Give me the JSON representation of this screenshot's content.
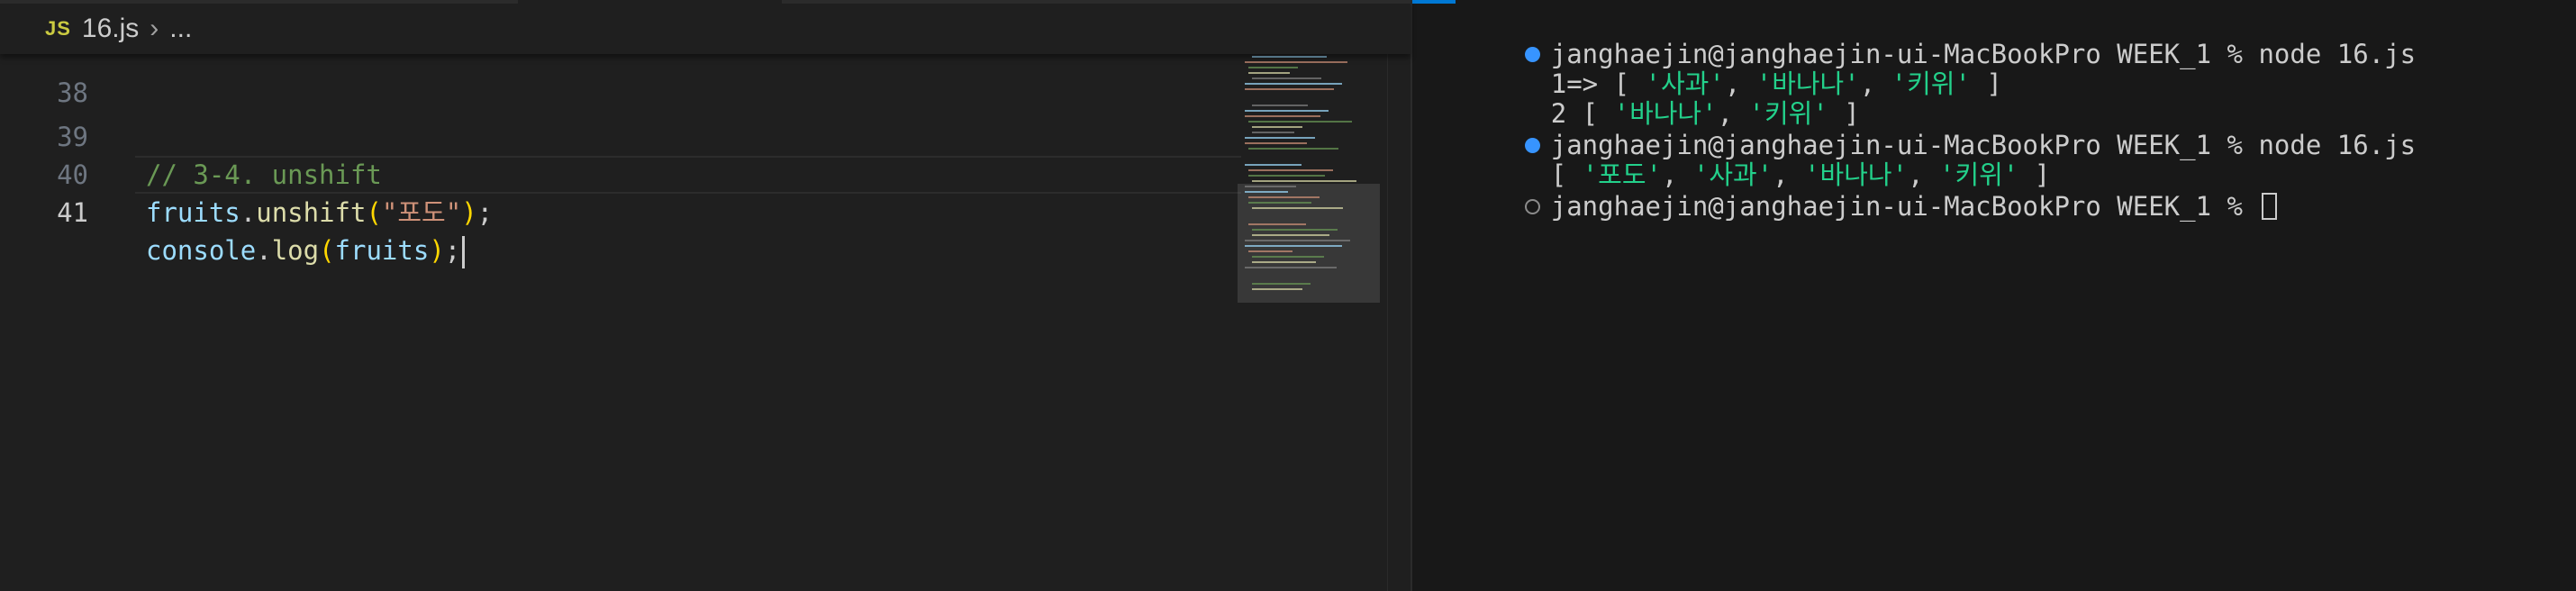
{
  "editor": {
    "breadcrumb": {
      "file_icon": "JS",
      "file_name": "16.js",
      "more": "..."
    },
    "lines": [
      {
        "number": "38"
      },
      {
        "number": "39",
        "comment": "// 3-4. unshift"
      },
      {
        "number": "40",
        "var": "fruits",
        "dot": ".",
        "method": "unshift",
        "open": "(",
        "arg": "\"포도\"",
        "close": ")",
        "semi": ";"
      },
      {
        "number": "41",
        "obj": "console",
        "dot": ".",
        "method": "log",
        "open": "(",
        "arg": "fruits",
        "close": ")",
        "semi": ";"
      }
    ]
  },
  "terminal": {
    "prompt": "janghaejin@janghaejin-ui-MacBookPro WEEK_1 %",
    "lines": [
      {
        "type": "prompt",
        "status": "done",
        "command": "node 16.js"
      },
      {
        "type": "output",
        "prefix": "1=> [ ",
        "items": [
          "'사과'",
          "'바나나'",
          "'키위'"
        ],
        "suffix": " ]"
      },
      {
        "type": "output",
        "prefix": "2 [ ",
        "items": [
          "'바나나'",
          "'키위'"
        ],
        "suffix": " ]"
      },
      {
        "type": "prompt",
        "status": "done",
        "command": "node 16.js"
      },
      {
        "type": "output",
        "prefix": "[ ",
        "items": [
          "'포도'",
          "'사과'",
          "'바나나'",
          "'키위'"
        ],
        "suffix": " ]"
      },
      {
        "type": "prompt",
        "status": "idle",
        "command": ""
      }
    ],
    "separator": ", "
  },
  "colors": {
    "comment": "#6a9955",
    "variable": "#9cdcfe",
    "function": "#dcdcaa",
    "string": "#ce9178",
    "terminal_string": "#23d18b",
    "status_dot": "#3794ff"
  }
}
